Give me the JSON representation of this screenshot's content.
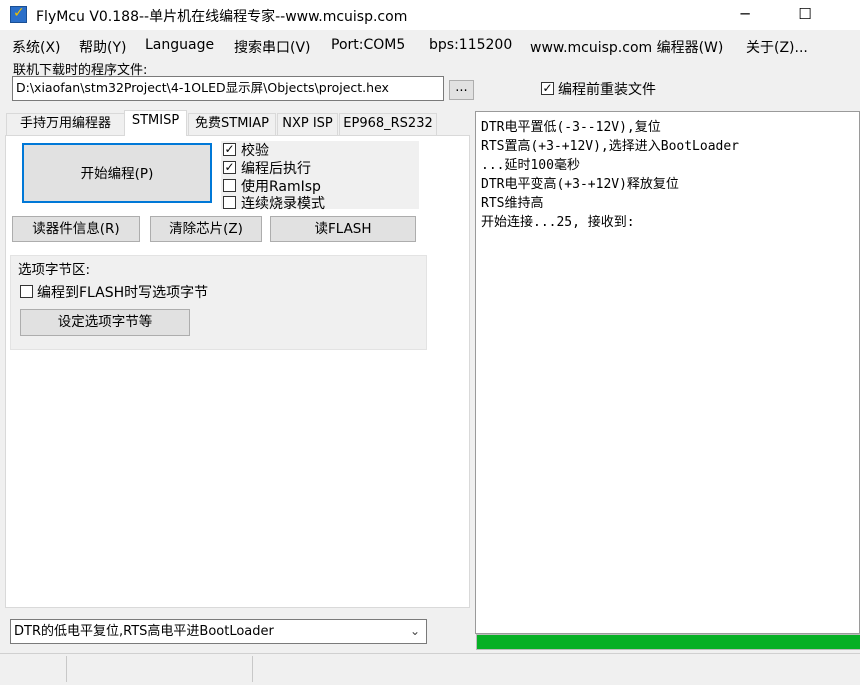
{
  "window": {
    "title": "FlyMcu V0.188--单片机在线编程专家--www.mcuisp.com",
    "icon": "flymcu-app-icon",
    "minimize": "─",
    "maximize": "☐"
  },
  "menu": [
    {
      "label": "系统(X)"
    },
    {
      "label": "帮助(Y)"
    },
    {
      "label": "Language"
    },
    {
      "label": "搜索串口(V)"
    },
    {
      "label": "Port:COM5"
    },
    {
      "label": "bps:115200"
    },
    {
      "label": "www.mcuisp.com 编程器(W)"
    },
    {
      "label": "关于(Z)..."
    }
  ],
  "file": {
    "label": "联机下载时的程序文件:",
    "path": "D:\\xiaofan\\stm32Project\\4-1OLED显示屏\\Objects\\project.hex",
    "browse": "...",
    "reload_label": "编程前重装文件",
    "reload_checked": true
  },
  "tabs": [
    {
      "label": "手持万用编程器"
    },
    {
      "label": "STMISP"
    },
    {
      "label": "免费STMIAP"
    },
    {
      "label": "NXP ISP"
    },
    {
      "label": "EP968_RS232"
    }
  ],
  "stmisp": {
    "start_button": "开始编程(P)",
    "options": [
      {
        "label": "校验",
        "checked": true
      },
      {
        "label": "编程后执行",
        "checked": true
      },
      {
        "label": "使用RamIsp",
        "checked": false
      },
      {
        "label": "连续烧录模式",
        "checked": false
      }
    ],
    "read_info_button": "读器件信息(R)",
    "erase_button": "清除芯片(Z)",
    "read_flash_button": "读FLASH",
    "option_bytes": {
      "title": "选项字节区:",
      "write_checkbox_label": "编程到FLASH时写选项字节",
      "write_checked": false,
      "settings_button": "设定选项字节等"
    }
  },
  "reset_mode": {
    "selected": "DTR的低电平复位,RTS高电平进BootLoader"
  },
  "log": [
    "DTR电平置低(-3--12V),复位",
    "RTS置高(+3-+12V),选择进入BootLoader",
    "...延时100毫秒",
    "DTR电平变高(+3-+12V)释放复位",
    "RTS维持高",
    "开始连接...25, 接收到:"
  ],
  "progress": {
    "value": 1.0,
    "color": "#06b025"
  }
}
